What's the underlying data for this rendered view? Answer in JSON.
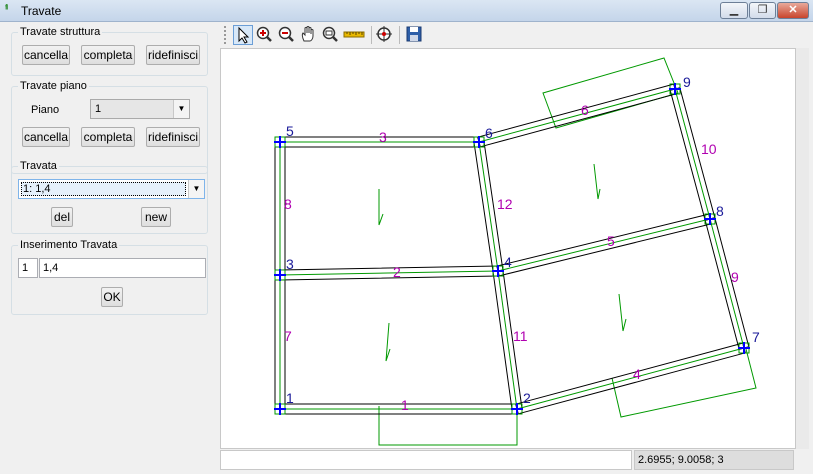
{
  "window": {
    "icon": "app-icon",
    "title": "Travate",
    "controls": {
      "minimize": "minimize-icon",
      "restore": "restore-icon",
      "close": "close-icon"
    }
  },
  "panel": {
    "struttura": {
      "title": "Travate struttura",
      "cancella": "cancella",
      "completa": "completa",
      "ridefinisci": "ridefinisci"
    },
    "piano": {
      "title": "Travate piano",
      "piano_label": "Piano",
      "piano_value": "1",
      "cancella": "cancella",
      "completa": "completa",
      "ridefinisci": "ridefinisci"
    },
    "travata": {
      "title": "Travata",
      "selected": "1: 1,4",
      "del": "del",
      "new": "new"
    },
    "inserimento": {
      "title": "Inserimento Travata",
      "index": "1",
      "value": "1,4",
      "ok": "OK"
    }
  },
  "toolbar": {
    "tools": [
      "pointer-icon",
      "zoom-in-icon",
      "zoom-out-icon",
      "pan-hand-icon",
      "zoom-window-icon",
      "measure-ruler-icon",
      "zoom-extents-icon",
      "save-icon"
    ],
    "active": "pointer-icon"
  },
  "drawing": {
    "beam_labels": [
      "1",
      "2",
      "3",
      "4",
      "5",
      "6",
      "7",
      "8",
      "9",
      "10",
      "11",
      "12"
    ],
    "node_labels": [
      "1",
      "2",
      "3",
      "4",
      "5",
      "6",
      "7",
      "8",
      "9"
    ],
    "colors": {
      "beam_outline": "#000000",
      "beam_axis": "#009900",
      "label_beam": "#b000b0",
      "label_node": "#1a1a99",
      "node": "#0000ff",
      "load": "#009900"
    }
  },
  "status": {
    "message": "",
    "coords": "2.6955; 9.0058; 3"
  }
}
